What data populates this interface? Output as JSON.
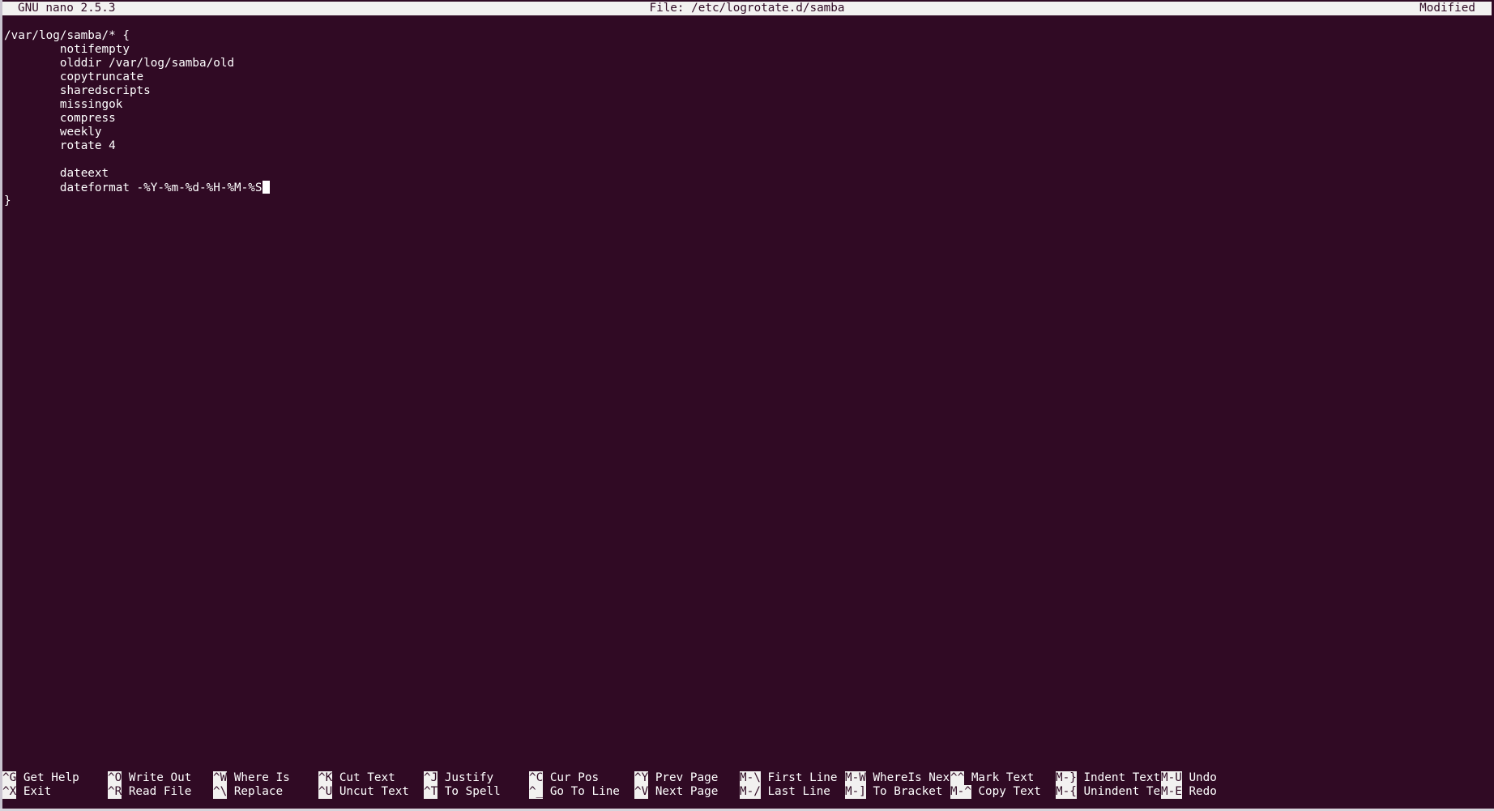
{
  "titlebar": {
    "version": "GNU nano 2.5.3",
    "filename": "File: /etc/logrotate.d/samba",
    "status": "Modified"
  },
  "editor": {
    "lines": [
      "/var/log/samba/* {",
      "\tnotifempty",
      "\tolddir /var/log/samba/old",
      "\tcopytruncate",
      "\tsharedscripts",
      "\tmissingok",
      "\tcompress",
      "\tweekly",
      "\trotate 4",
      "",
      "\tdateext",
      "\tdateformat -%Y-%m-%d-%H-%M-%S",
      "}"
    ]
  },
  "shortcuts": {
    "row1": [
      {
        "key": "^G",
        "label": "Get Help"
      },
      {
        "key": "^O",
        "label": "Write Out"
      },
      {
        "key": "^W",
        "label": "Where Is"
      },
      {
        "key": "^K",
        "label": "Cut Text"
      },
      {
        "key": "^J",
        "label": "Justify"
      },
      {
        "key": "^C",
        "label": "Cur Pos"
      },
      {
        "key": "^Y",
        "label": "Prev Page"
      },
      {
        "key": "M-\\",
        "label": "First Line"
      },
      {
        "key": "M-W",
        "label": "WhereIs Next"
      },
      {
        "key": "^^",
        "label": "Mark Text"
      },
      {
        "key": "M-}",
        "label": "Indent Text"
      },
      {
        "key": "M-U",
        "label": "Undo"
      }
    ],
    "row2": [
      {
        "key": "^X",
        "label": "Exit"
      },
      {
        "key": "^R",
        "label": "Read File"
      },
      {
        "key": "^\\",
        "label": "Replace"
      },
      {
        "key": "^U",
        "label": "Uncut Text"
      },
      {
        "key": "^T",
        "label": "To Spell"
      },
      {
        "key": "^_",
        "label": "Go To Line"
      },
      {
        "key": "^V",
        "label": "Next Page"
      },
      {
        "key": "M-/",
        "label": "Last Line"
      },
      {
        "key": "M-]",
        "label": "To Bracket"
      },
      {
        "key": "M-^",
        "label": "Copy Text"
      },
      {
        "key": "M-{",
        "label": "Unindent Text"
      },
      {
        "key": "M-E",
        "label": "Redo"
      }
    ]
  },
  "colors": {
    "background": "#300a24",
    "foreground": "#ffffff",
    "highlight": "#f2f1f0"
  }
}
